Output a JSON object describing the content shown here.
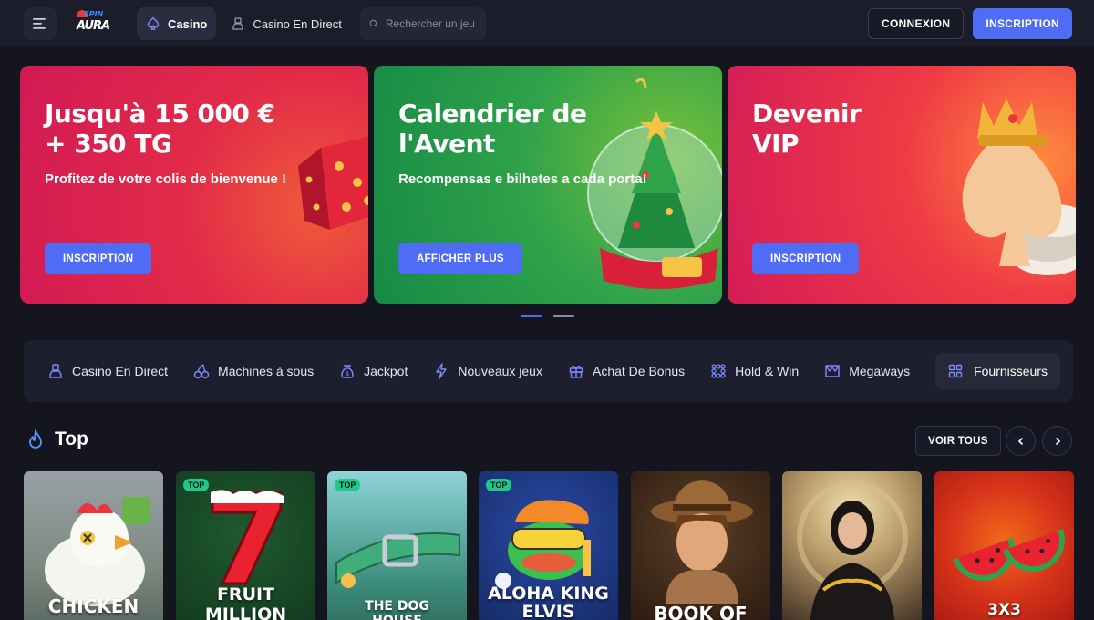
{
  "header": {
    "logo_text": "SPIN AURA",
    "tabs": [
      {
        "label": "Casino"
      },
      {
        "label": "Casino En Direct"
      }
    ],
    "search_placeholder": "Rechercher un jeu",
    "login_label": "CONNEXION",
    "signup_label": "INSCRIPTION"
  },
  "banners": [
    {
      "title_line1": "Jusqu'à 15 000 €",
      "title_line2": "+ 350 TG",
      "subtitle": "Profitez de votre colis de bienvenue !",
      "cta": "INSCRIPTION"
    },
    {
      "title_line1": "Calendrier de",
      "title_line2": "l'Avent",
      "subtitle": "Recompensas e bilhetes a cada porta!",
      "cta": "AFFICHER PLUS"
    },
    {
      "title_line1": "Devenir",
      "title_line2": "VIP",
      "subtitle": "",
      "cta": "INSCRIPTION"
    }
  ],
  "carousel": {
    "active_index": 0,
    "count": 2
  },
  "categories": [
    {
      "label": "Casino En Direct",
      "icon": "dealer-icon"
    },
    {
      "label": "Machines à sous",
      "icon": "cherries-icon"
    },
    {
      "label": "Jackpot",
      "icon": "money-bag-icon"
    },
    {
      "label": "Nouveaux jeux",
      "icon": "lightning-icon"
    },
    {
      "label": "Achat De Bonus",
      "icon": "gift-icon"
    },
    {
      "label": "Hold & Win",
      "icon": "grid-dots-icon"
    },
    {
      "label": "Megaways",
      "icon": "megaways-icon"
    }
  ],
  "providers_label": "Fournisseurs",
  "top": {
    "title": "Top",
    "see_all": "VOIR TOUS",
    "games": [
      {
        "title": "CHICKEN",
        "badge": ""
      },
      {
        "title": "FRUIT MILLION",
        "badge": "TOP"
      },
      {
        "title": "THE DOG HOUSE",
        "badge": "TOP"
      },
      {
        "title": "ALOHA KING ELVIS",
        "badge": "TOP"
      },
      {
        "title": "BOOK OF RA",
        "badge": ""
      },
      {
        "title": "",
        "badge": ""
      },
      {
        "title": "3X3",
        "badge": ""
      }
    ]
  },
  "colors": {
    "accent": "#4f6cf5",
    "background": "#14151f",
    "header": "#1c1d2b",
    "badge": "#1fc98a"
  }
}
